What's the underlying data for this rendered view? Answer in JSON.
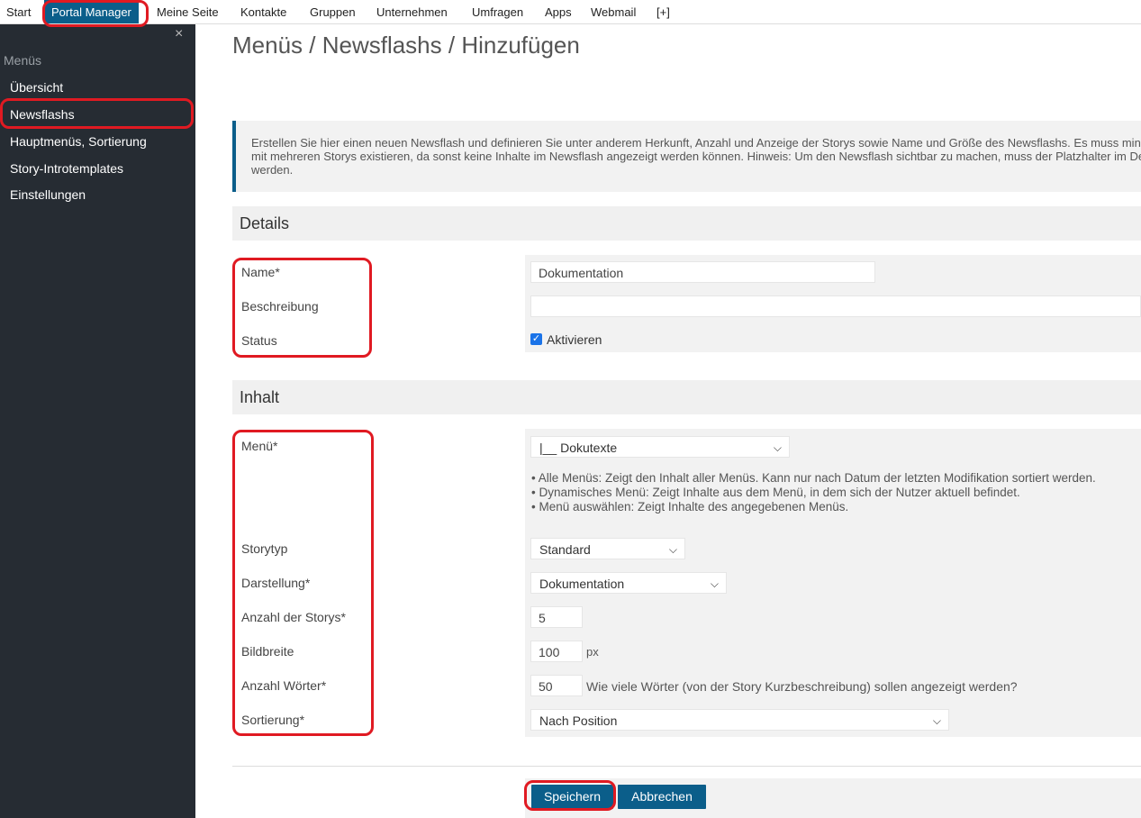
{
  "topnav": {
    "items": [
      "Start",
      "Portal Manager",
      "Meine Seite",
      "Kontakte",
      "Gruppen",
      "Unternehmen",
      "Umfragen",
      "Apps",
      "Webmail",
      "[+]"
    ]
  },
  "sidebar": {
    "close": "×",
    "heading": "Menüs",
    "items": [
      "Übersicht",
      "Newsflashs",
      "Hauptmenüs, Sortierung",
      "Story-Introtemplates",
      "Einstellungen"
    ]
  },
  "main": {
    "title": "Menüs / Newsflashs / Hinzufügen",
    "info": "Erstellen Sie hier einen neuen Newsflash und definieren Sie unter anderem Herkunft, Anzahl und Anzeige der Storys sowie Name und Größe des Newsflashs. Es muss mindestens ein Menü mit mehreren Storys existieren, da sonst keine Inhalte im Newsflash angezeigt werden können. Hinweis: Um den Newsflash sichtbar zu machen, muss der Platzhalter im Design integriert werden."
  },
  "details": {
    "heading": "Details",
    "name_label": "Name*",
    "name_value": "Dokumentation",
    "desc_label": "Beschreibung",
    "desc_value": "",
    "status_label": "Status",
    "status_checkbox": "Aktivieren",
    "status_checked": true
  },
  "inhalt": {
    "heading": "Inhalt",
    "menu_label": "Menü*",
    "menu_value": "|__ Dokutexte",
    "menu_help": [
      "Alle Menüs: Zeigt den Inhalt aller Menüs. Kann nur nach Datum der letzten Modifikation sortiert werden.",
      "Dynamisches Menü: Zeigt Inhalte aus dem Menü, in dem sich der Nutzer aktuell befindet.",
      "Menü auswählen: Zeigt Inhalte des angegebenen Menüs."
    ],
    "storytyp_label": "Storytyp",
    "storytyp_value": "Standard",
    "darstellung_label": "Darstellung*",
    "darstellung_value": "Dokumentation",
    "anzahl_label": "Anzahl der Storys*",
    "anzahl_value": "5",
    "bildbreite_label": "Bildbreite",
    "bildbreite_value": "100",
    "bildbreite_unit": "px",
    "woerter_label": "Anzahl Wörter*",
    "woerter_value": "50",
    "woerter_help": "Wie viele Wörter (von der Story Kurzbeschreibung) sollen angezeigt werden?",
    "sortierung_label": "Sortierung*",
    "sortierung_value": "Nach Position"
  },
  "buttons": {
    "save": "Speichern",
    "cancel": "Abbrechen"
  },
  "colors": {
    "accent": "#0b5e8a",
    "sidebar_bg": "#262c33",
    "highlight": "#e01a22"
  }
}
